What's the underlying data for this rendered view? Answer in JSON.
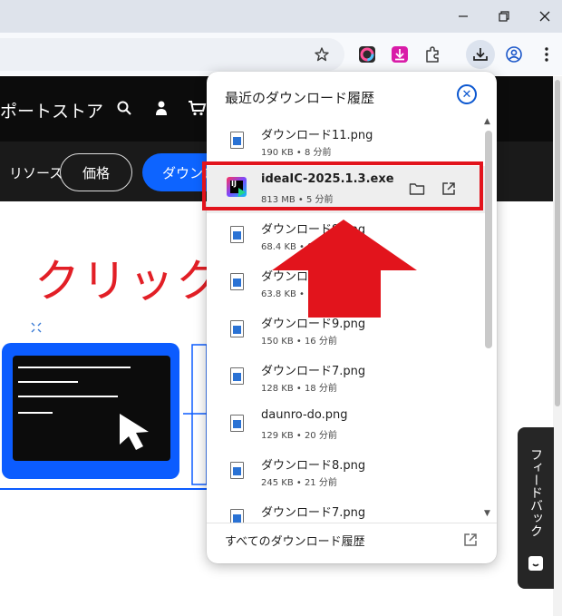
{
  "window": {
    "minimize_icon": "minimize-icon",
    "restore_icon": "restore-icon",
    "close_icon": "close-icon"
  },
  "toolbar": {
    "icons": [
      "bookmark-star-icon",
      "color-extension-icon",
      "download-extension-icon",
      "extensions-puzzle-icon",
      "downloads-icon",
      "profile-icon",
      "menu-kebab-icon"
    ]
  },
  "site_nav": {
    "support": "ポート",
    "store": "ストア",
    "icons": [
      "search-icon",
      "account-icon",
      "cart-icon"
    ]
  },
  "sub_nav": {
    "resources": "リソース",
    "pricing": "価格",
    "download": "ダウンロード"
  },
  "hero": {
    "text": "クリック"
  },
  "feedback": {
    "label": "フィードバック"
  },
  "download_bubble": {
    "title": "最近のダウンロード履歴",
    "items": [
      {
        "name": "ダウンロード11.png",
        "meta": "190 KB • 8 分前",
        "icon": "image-file-icon"
      },
      {
        "name": "ideaIC-2025.1.3.exe",
        "meta": "813 MB • 5 分前",
        "icon": "intellij-app-icon"
      },
      {
        "name": "ダウンロード9.png",
        "meta": "68.4 KB • 9 分前",
        "icon": "image-file-icon"
      },
      {
        "name": "ダウンロード",
        "meta": "63.8 KB • 1 分前",
        "icon": "image-file-icon"
      },
      {
        "name": "ダウンロード9.png",
        "meta": "150 KB • 16 分前",
        "icon": "image-file-icon"
      },
      {
        "name": "ダウンロード7.png",
        "meta": "128 KB • 18 分前",
        "icon": "image-file-icon"
      },
      {
        "name": "daunro-do.png",
        "meta": "129 KB • 20 分前",
        "icon": "image-file-icon"
      },
      {
        "name": "ダウンロード8.png",
        "meta": "245 KB • 21 分前",
        "icon": "image-file-icon"
      },
      {
        "name": "ダウンロード7.png",
        "meta": "",
        "icon": "image-file-icon"
      }
    ],
    "footer_link": "すべてのダウンロード履歴"
  },
  "colors": {
    "annotation_red": "#e2141c",
    "accent_blue": "#0b57d0",
    "brand_blue": "#0b5cff"
  }
}
